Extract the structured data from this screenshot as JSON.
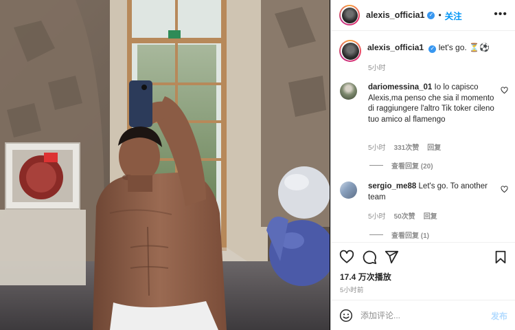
{
  "post": {
    "username": "alexis_officia1",
    "follow_label": "关注",
    "more_label": "•••",
    "caption_username": "alexis_officia1",
    "caption_text": "let's go. ⏳⚽",
    "caption_time": "5小时"
  },
  "comments": [
    {
      "username": "dariomessina_01",
      "text": "Io lo capisco Alexis,ma penso che sia il momento di raggiungere l'altro Tik toker cileno tuo amico al flamengo",
      "time": "5小时",
      "likes": "331次赞",
      "reply_label": "回复",
      "view_replies": "查看回复 (20)"
    },
    {
      "username": "sergio_me88",
      "text": "Let's go. To another team",
      "time": "5小时",
      "likes": "50次赞",
      "reply_label": "回复",
      "view_replies": "查看回复 (1)"
    }
  ],
  "stats": {
    "views": "17.4 万次播放",
    "posted_ago": "5小时前"
  },
  "add_comment": {
    "placeholder": "添加评论...",
    "post_label": "发布"
  },
  "icons": {
    "like": "heart-icon",
    "comment": "comment-icon",
    "share": "share-icon",
    "save": "bookmark-icon",
    "emoji": "emoji-icon",
    "menu": "more-icon"
  },
  "colors": {
    "accent": "#0095f6",
    "verified": "#3897f0",
    "secondary_text": "#8e8e8e",
    "disabled_post": "#b3dbff"
  }
}
